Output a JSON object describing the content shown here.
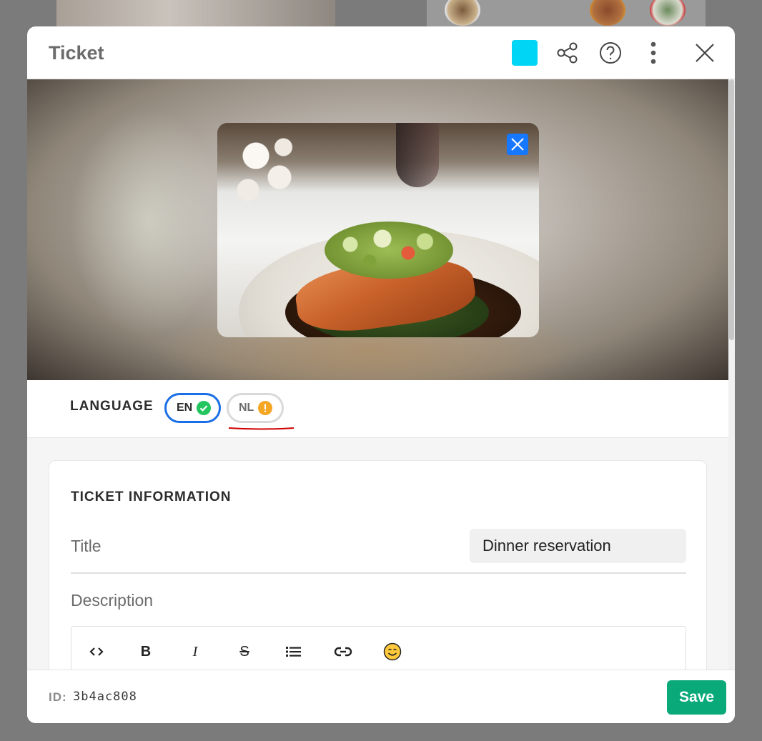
{
  "modal": {
    "title": "Ticket",
    "accent_color": "#00d5f5",
    "header_icons": [
      "share-icon",
      "help-icon",
      "more-icon",
      "close-icon"
    ]
  },
  "hero": {
    "image_subject": "salmon-dish-photo",
    "remove_icon": "close-icon"
  },
  "language": {
    "label": "LANGUAGE",
    "options": [
      {
        "code": "EN",
        "status": "complete",
        "status_color": "#22c55e",
        "selected": true
      },
      {
        "code": "NL",
        "status": "warning",
        "status_color": "#f5a623",
        "selected": false
      }
    ]
  },
  "ticket_info": {
    "heading": "TICKET INFORMATION",
    "title_label": "Title",
    "title_value": "Dinner reservation",
    "description_label": "Description",
    "toolbar": [
      "code-icon",
      "bold-icon",
      "italic-icon",
      "strikethrough-icon",
      "list-icon",
      "link-icon",
      "emoji-icon"
    ],
    "toolbar_text": {
      "bold": "B",
      "italic": "I",
      "strike": "S"
    }
  },
  "footer": {
    "id_label": "ID:",
    "id_value": "3b4ac808",
    "save_label": "Save",
    "save_color": "#0aa97a"
  }
}
